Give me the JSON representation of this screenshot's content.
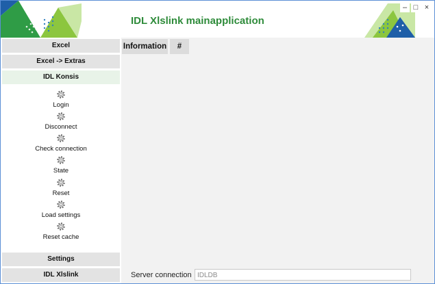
{
  "window": {
    "title": "IDL Xlslink mainapplication",
    "controls": {
      "minimize": "–",
      "maximize": "□",
      "close": "×"
    }
  },
  "sidebar": {
    "sections": {
      "excel": "Excel",
      "excel_extras": "Excel -> Extras",
      "idl_konsis": "IDL Konsis",
      "settings": "Settings",
      "idl_xlslink": "IDL Xlslink"
    },
    "items": [
      {
        "label": "Login",
        "icon": "gear-icon"
      },
      {
        "label": "Disconnect",
        "icon": "gear-icon"
      },
      {
        "label": "Check connection",
        "icon": "gear-icon"
      },
      {
        "label": "State",
        "icon": "gear-icon"
      },
      {
        "label": "Reset",
        "icon": "gear-icon"
      },
      {
        "label": "Load settings",
        "icon": "gear-icon"
      },
      {
        "label": "Reset cache",
        "icon": "gear-icon"
      }
    ]
  },
  "main": {
    "tabs": [
      {
        "label": "Information"
      },
      {
        "label": "#"
      }
    ]
  },
  "status": {
    "label": "Server connection",
    "value": "IDLDB"
  },
  "colors": {
    "brand_green": "#2e8b3a",
    "accent_blue": "#1f5fa8",
    "section_bg": "#e3e3e3",
    "active_section_bg": "#e8f3e8",
    "content_bg": "#f2f2f2"
  }
}
